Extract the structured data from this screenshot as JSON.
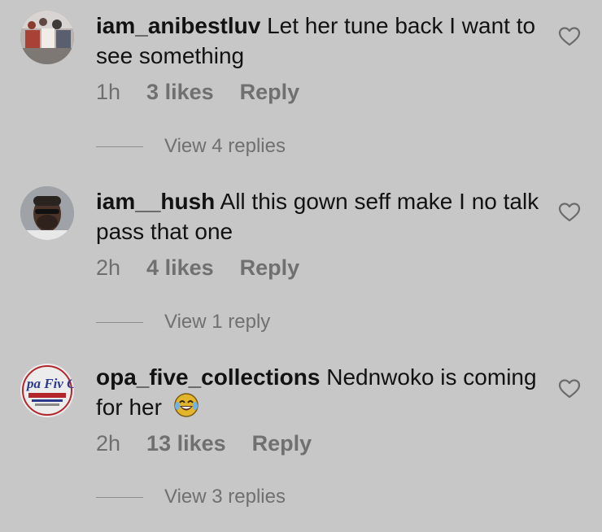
{
  "comments": [
    {
      "username": "iam_anibestluv",
      "text": "Let her tune back I want to see something",
      "time": "1h",
      "likes": "3 likes",
      "reply_label": "Reply",
      "view_replies": "View 4 replies",
      "avatar_icon": "profile-photo"
    },
    {
      "username": "iam__hush",
      "text": "All this gown seff make I no talk pass that one",
      "time": "2h",
      "likes": "4 likes",
      "reply_label": "Reply",
      "view_replies": "View 1 reply",
      "avatar_icon": "profile-photo"
    },
    {
      "username": "opa_five_collections",
      "text": "Nednwoko is coming for her",
      "emoji": "face-with-tears-of-joy",
      "time": "2h",
      "likes": "13 likes",
      "reply_label": "Reply",
      "view_replies": "View 3 replies",
      "avatar_icon": "brand-logo",
      "avatar_logo_text": "pa Fiv Collectio"
    }
  ],
  "colors": {
    "background": "#c7c7c7",
    "text": "#121212",
    "muted": "#707070"
  }
}
